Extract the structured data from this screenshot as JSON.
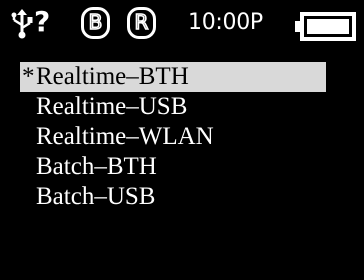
{
  "status_bar": {
    "usb_icon": "usb-icon",
    "connection_status": "?",
    "badges": [
      {
        "letter": "B",
        "icon": "bluetooth-badge-icon"
      },
      {
        "letter": "R",
        "icon": "realtime-badge-icon"
      }
    ],
    "time": "10:00P",
    "battery_icon": "battery-icon",
    "battery_level": 1.0
  },
  "menu": {
    "selected_index": 0,
    "selected_marker": "*",
    "items": [
      {
        "label": "Realtime–BTH"
      },
      {
        "label": "Realtime–USB"
      },
      {
        "label": "Realtime–WLAN"
      },
      {
        "label": "Batch–BTH"
      },
      {
        "label": "Batch–USB"
      }
    ]
  },
  "colors": {
    "background": "#000000",
    "foreground": "#ffffff",
    "highlight": "#d9d9d9",
    "highlight_text": "#000000"
  }
}
